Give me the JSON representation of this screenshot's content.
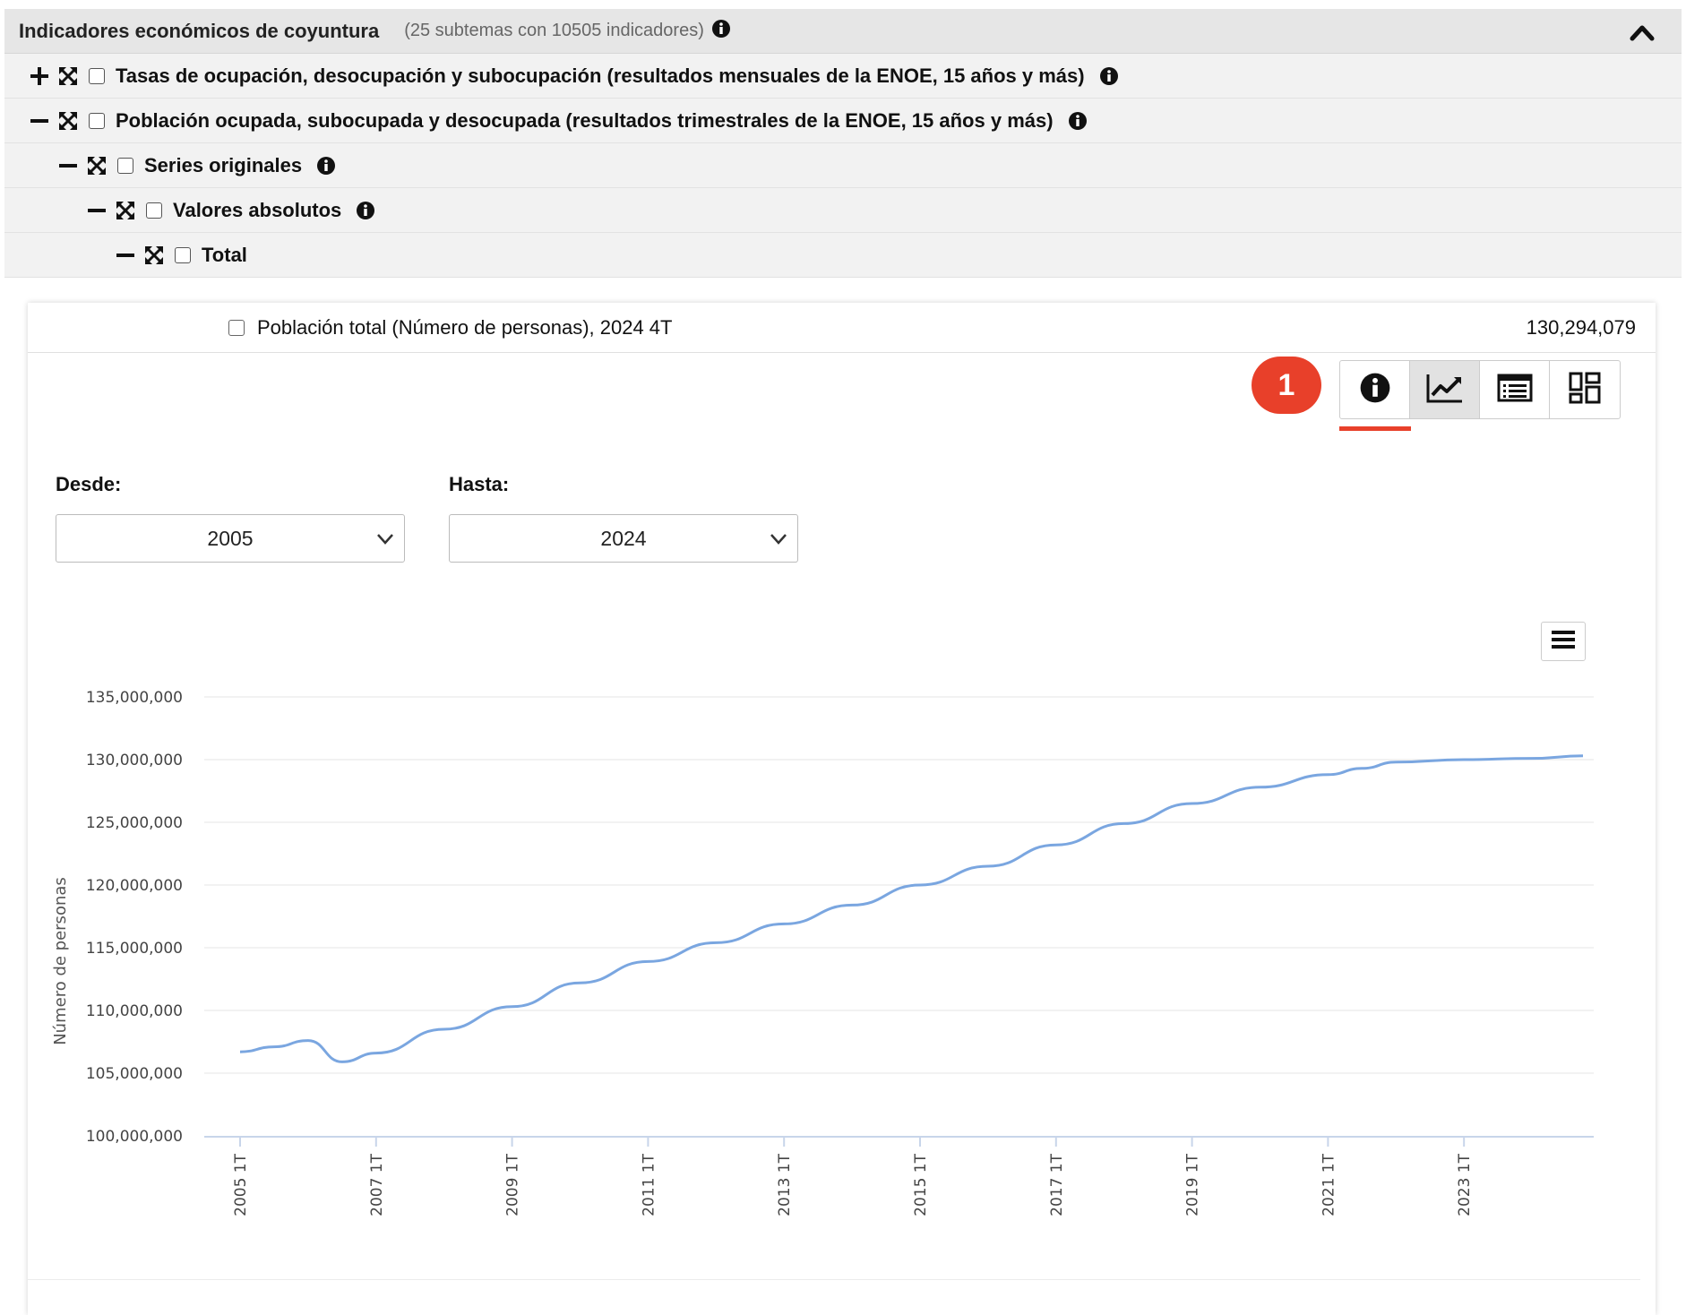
{
  "tree": {
    "header": {
      "title": "Indicadores económicos de coyuntura",
      "count": "(25 subtemas con 10505 indicadores)"
    },
    "rows": [
      {
        "toggle": "plus",
        "label": "Tasas de ocupación, desocupación y subocupación (resultados mensuales de la ENOE, 15 años y más)",
        "info": true
      },
      {
        "toggle": "minus",
        "label": "Población ocupada, subocupada y desocupada (resultados trimestrales de la ENOE, 15 años y más)",
        "info": true
      },
      {
        "toggle": "minus",
        "label": "Series originales",
        "info": true
      },
      {
        "toggle": "minus",
        "label": "Valores absolutos",
        "info": true
      },
      {
        "toggle": "minus",
        "label": "Total",
        "info": false
      }
    ]
  },
  "indicator": {
    "label": "Población total (Número de personas), 2024  4T",
    "value": "130,294,079"
  },
  "badge": "1",
  "view_buttons": [
    {
      "icon": "info-icon",
      "active": false
    },
    {
      "icon": "line-chart-icon",
      "active": true
    },
    {
      "icon": "table-icon",
      "active": false
    },
    {
      "icon": "dashboard-icon",
      "active": false
    }
  ],
  "filters": {
    "desde_label": "Desde:",
    "desde_value": "2005",
    "hasta_label": "Hasta:",
    "hasta_value": "2024"
  },
  "colors": {
    "accent": "#e8402a",
    "line": "#7aa6e0"
  },
  "chart_data": {
    "type": "line",
    "ylabel": "Número de personas",
    "ylim": [
      100000000,
      135000000
    ],
    "yticks": [
      "100,000,000",
      "105,000,000",
      "110,000,000",
      "115,000,000",
      "120,000,000",
      "125,000,000",
      "130,000,000",
      "135,000,000"
    ],
    "xticks": [
      "2005 1T",
      "2007 1T",
      "2009 1T",
      "2011 1T",
      "2013 1T",
      "2015 1T",
      "2017 1T",
      "2019 1T",
      "2021 1T",
      "2023 1T"
    ],
    "grid": true,
    "legend": "none",
    "series": [
      {
        "x": [
          "2005 1T",
          "2005 3T",
          "2006 1T",
          "2006 3T",
          "2007 1T",
          "2008 1T",
          "2009 1T",
          "2010 1T",
          "2011 1T",
          "2012 1T",
          "2013 1T",
          "2014 1T",
          "2015 1T",
          "2016 1T",
          "2017 1T",
          "2018 1T",
          "2019 1T",
          "2020 1T",
          "2021 1T",
          "2021 3T",
          "2022 1T",
          "2023 1T",
          "2024 1T",
          "2024 4T"
        ],
        "values": [
          106700000,
          107100000,
          107600000,
          105900000,
          106600000,
          108500000,
          110300000,
          112200000,
          113900000,
          115400000,
          116900000,
          118400000,
          120000000,
          121500000,
          123200000,
          124900000,
          126500000,
          127800000,
          128800000,
          129300000,
          129800000,
          130000000,
          130100000,
          130300000
        ]
      }
    ]
  }
}
